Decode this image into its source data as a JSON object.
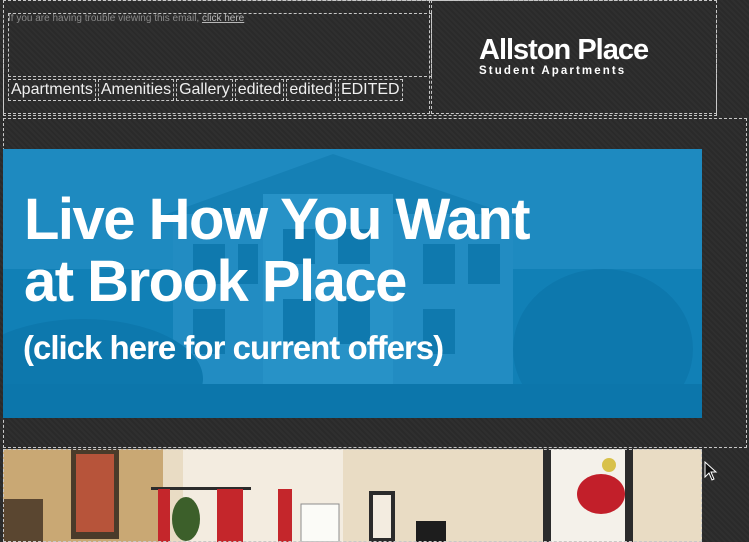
{
  "preheader": {
    "text": "If you are having trouble viewing this email,",
    "link": "click here"
  },
  "nav": {
    "items": [
      {
        "label": "Apartments"
      },
      {
        "label": "Amenities"
      },
      {
        "label": "Gallery"
      },
      {
        "label": "edited"
      },
      {
        "label": "edited"
      },
      {
        "label": "EDITED"
      }
    ]
  },
  "logo": {
    "name": "Allston Place",
    "tagline": "Student Apartments"
  },
  "hero": {
    "headline_line1": "Live How You Want",
    "headline_line2": "at Brook Place",
    "cta": "(click here for current offers)"
  },
  "colors": {
    "page_bg": "#2a2a2a",
    "hero_blue": "#0b87c3",
    "dashed_outline": "#c8c8c8"
  },
  "icons": {
    "cursor": "mouse-pointer-icon"
  }
}
